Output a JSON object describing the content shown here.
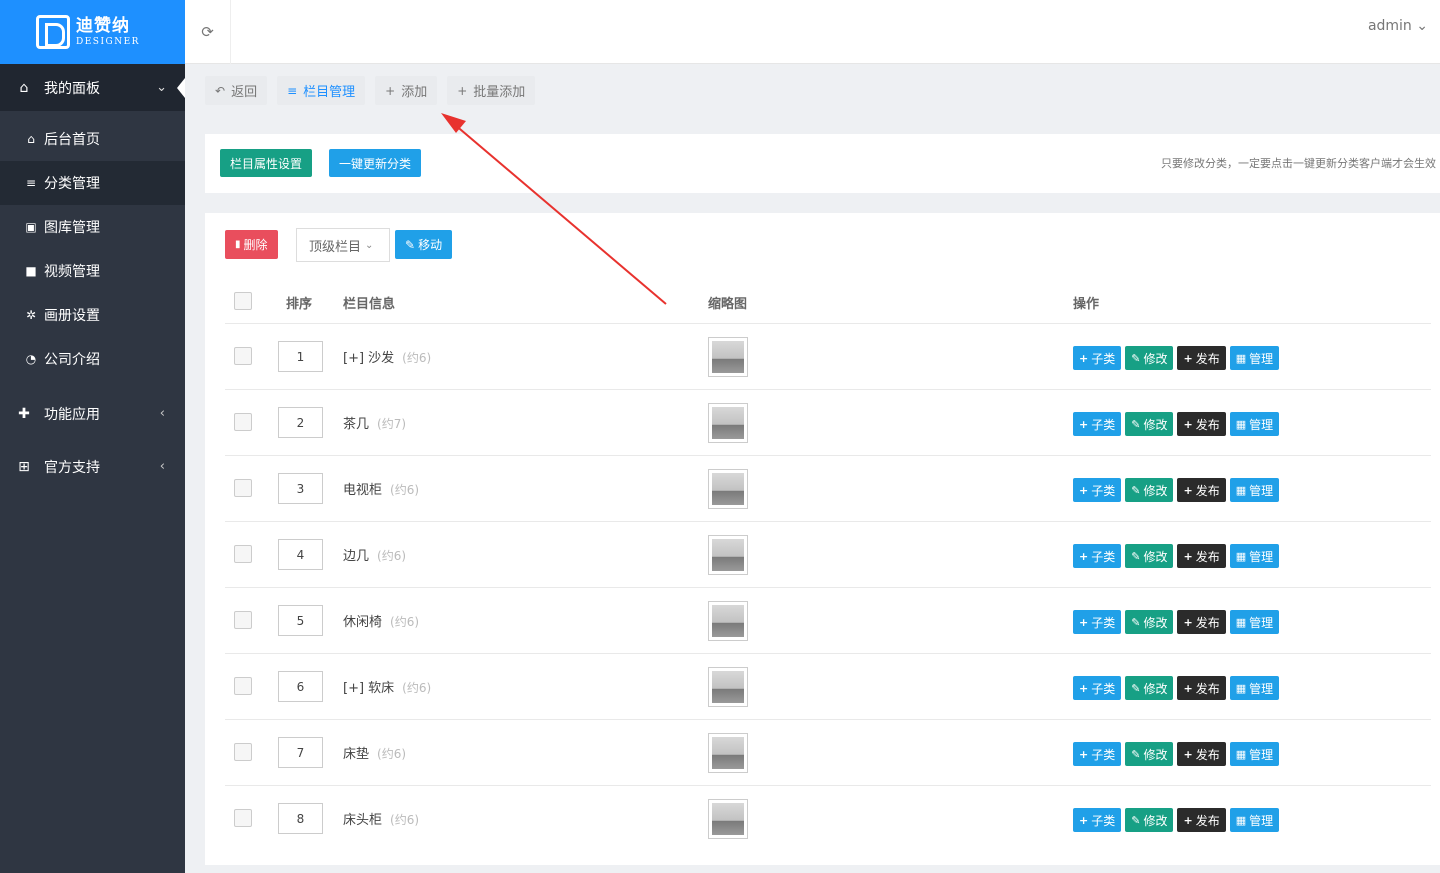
{
  "brand": {
    "name_cn": "迪赞纳",
    "name_en": "DESIGNER"
  },
  "header": {
    "user": "admin",
    "user_caret": "⌄"
  },
  "sidebar": {
    "dashboard": {
      "label": "我的面板",
      "icon": "home-icon",
      "arrow": "⌄"
    },
    "items": [
      {
        "label": "后台首页",
        "icon": "home-icon",
        "glyph": "⌂"
      },
      {
        "label": "分类管理",
        "icon": "list-icon",
        "glyph": "≡"
      },
      {
        "label": "图库管理",
        "icon": "image-icon",
        "glyph": "▣"
      },
      {
        "label": "视频管理",
        "icon": "video-icon",
        "glyph": "■"
      },
      {
        "label": "画册设置",
        "icon": "gear-icon",
        "glyph": "✲"
      },
      {
        "label": "公司介绍",
        "icon": "compass-icon",
        "glyph": "◔"
      }
    ],
    "groups": [
      {
        "label": "功能应用",
        "icon": "puzzle-icon",
        "glyph": "✚",
        "arrow": "‹"
      },
      {
        "label": "官方支持",
        "icon": "support-icon",
        "glyph": "⊞",
        "arrow": "‹"
      }
    ]
  },
  "toolbar": {
    "back": {
      "label": "返回",
      "glyph": "↶"
    },
    "category": {
      "label": "栏目管理",
      "glyph": "≡"
    },
    "add": {
      "label": "添加",
      "glyph": "+"
    },
    "batch_add": {
      "label": "批量添加",
      "glyph": "+"
    }
  },
  "panel1": {
    "attr_settings": "栏目属性设置",
    "update_categories": "一键更新分类",
    "notice": "只要修改分类，一定要点击一键更新分类客户端才会生效"
  },
  "panel2": {
    "delete_label": "删除",
    "delete_glyph": "▮",
    "select_value": "顶级栏目",
    "select_caret": "⌄",
    "move_label": "移动",
    "move_glyph": "✎"
  },
  "table": {
    "headers": {
      "sort": "排序",
      "info": "栏目信息",
      "thumb": "缩略图",
      "ops": "操作"
    },
    "ops": {
      "sub": "子类",
      "sub_glyph": "+",
      "edit": "修改",
      "edit_glyph": "✎",
      "publish": "发布",
      "publish_glyph": "+",
      "manage": "管理",
      "manage_glyph": "▦"
    },
    "rows": [
      {
        "sort": "1",
        "name": "[+] 沙发",
        "count": "(约6)"
      },
      {
        "sort": "2",
        "name": "茶几",
        "count": "(约7)"
      },
      {
        "sort": "3",
        "name": "电视柜",
        "count": "(约6)"
      },
      {
        "sort": "4",
        "name": "边几",
        "count": "(约6)"
      },
      {
        "sort": "5",
        "name": "休闲椅",
        "count": "(约6)"
      },
      {
        "sort": "6",
        "name": "[+] 软床",
        "count": "(约6)"
      },
      {
        "sort": "7",
        "name": "床垫",
        "count": "(约6)"
      },
      {
        "sort": "8",
        "name": "床头柜",
        "count": "(约6)"
      }
    ]
  },
  "colors": {
    "brand_blue": "#1e90ff",
    "sidebar_bg": "#2f3642",
    "teal": "#17a085",
    "sky": "#20a0e8",
    "red": "#e94e5d",
    "dark": "#2b2b2b",
    "annotation_arrow": "#e8322e"
  }
}
